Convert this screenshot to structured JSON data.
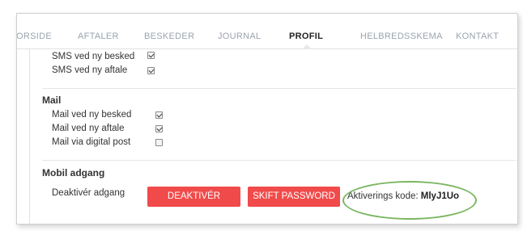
{
  "nav": {
    "items": [
      "FORSIDE",
      "AFTALER",
      "BESKEDER",
      "JOURNAL",
      "PROFIL",
      "HELBREDSSKEMA",
      "KONTAKT"
    ],
    "active_index": 4
  },
  "sms": {
    "rows": [
      {
        "label": "SMS ved ny besked",
        "checked": true
      },
      {
        "label": "SMS ved ny aftale",
        "checked": true
      }
    ]
  },
  "mail": {
    "heading": "Mail",
    "rows": [
      {
        "label": "Mail ved ny besked",
        "checked": true
      },
      {
        "label": "Mail ved ny aftale",
        "checked": true
      },
      {
        "label": "Mail via digital post",
        "checked": false
      }
    ]
  },
  "mobile": {
    "heading": "Mobil adgang",
    "deactivate_label": "Deaktivér adgang",
    "deactivate_button": "DEAKTIVÉR",
    "password_button": "SKIFT PASSWORD",
    "activation_label": "Aktiverings kode:",
    "activation_code": "MlyJ1Uo"
  },
  "colors": {
    "button": "#f14a4a",
    "highlight_oval": "#7bb661",
    "nav_inactive": "#9aa3ad",
    "nav_active": "#222222"
  }
}
